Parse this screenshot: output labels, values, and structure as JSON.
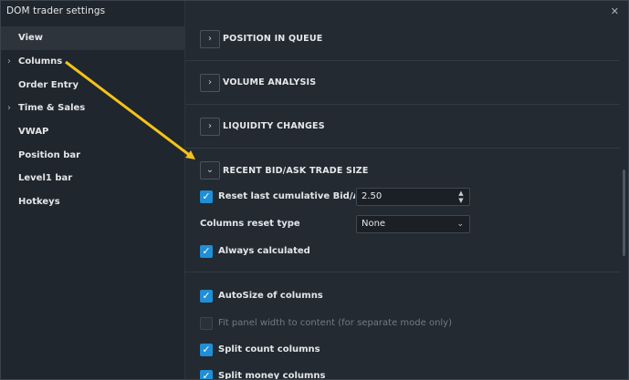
{
  "window": {
    "title": "DOM trader settings",
    "close_glyph": "✕"
  },
  "sidebar": {
    "items": [
      {
        "label": "View",
        "expandable": false,
        "active": true
      },
      {
        "label": "Columns",
        "expandable": true,
        "active": false
      },
      {
        "label": "Order Entry",
        "expandable": false,
        "active": false
      },
      {
        "label": "Time & Sales",
        "expandable": true,
        "active": false
      },
      {
        "label": "VWAP",
        "expandable": false,
        "active": false
      },
      {
        "label": "Position bar",
        "expandable": false,
        "active": false
      },
      {
        "label": "Level1 bar",
        "expandable": false,
        "active": false
      },
      {
        "label": "Hotkeys",
        "expandable": false,
        "active": false
      }
    ],
    "chevron_glyph": "›"
  },
  "sections": [
    {
      "title": "POSITION IN QUEUE",
      "expanded": false,
      "toggle_glyph": "›"
    },
    {
      "title": "VOLUME ANALYSIS",
      "expanded": false,
      "toggle_glyph": "›"
    },
    {
      "title": "LIQUIDITY CHANGES",
      "expanded": false,
      "toggle_glyph": "›"
    },
    {
      "title": "RECENT BID/ASK TRADE SIZE",
      "expanded": true,
      "toggle_glyph": "⌄"
    }
  ],
  "recent_trade_size": {
    "reset_cumulative": {
      "label": "Reset last cumulative Bid/Ask T",
      "checked": true,
      "value": "2.50"
    },
    "columns_reset_type": {
      "label": "Columns reset type",
      "value": "None"
    },
    "always_calculated": {
      "label": "Always calculated",
      "checked": true
    }
  },
  "options": [
    {
      "label": "AutoSize of columns",
      "checked": true,
      "enabled": true
    },
    {
      "label": "Fit panel width to content (for separate mode only)",
      "checked": false,
      "enabled": false
    },
    {
      "label": "Split count columns",
      "checked": true,
      "enabled": true
    },
    {
      "label": "Split money columns",
      "checked": true,
      "enabled": true
    }
  ],
  "glyphs": {
    "check": "✓",
    "spin_up": "▲",
    "spin_down": "▼",
    "dropdown": "⌄"
  },
  "colors": {
    "accent": "#1f8fd6",
    "annotation_arrow": "#f5c21b"
  }
}
